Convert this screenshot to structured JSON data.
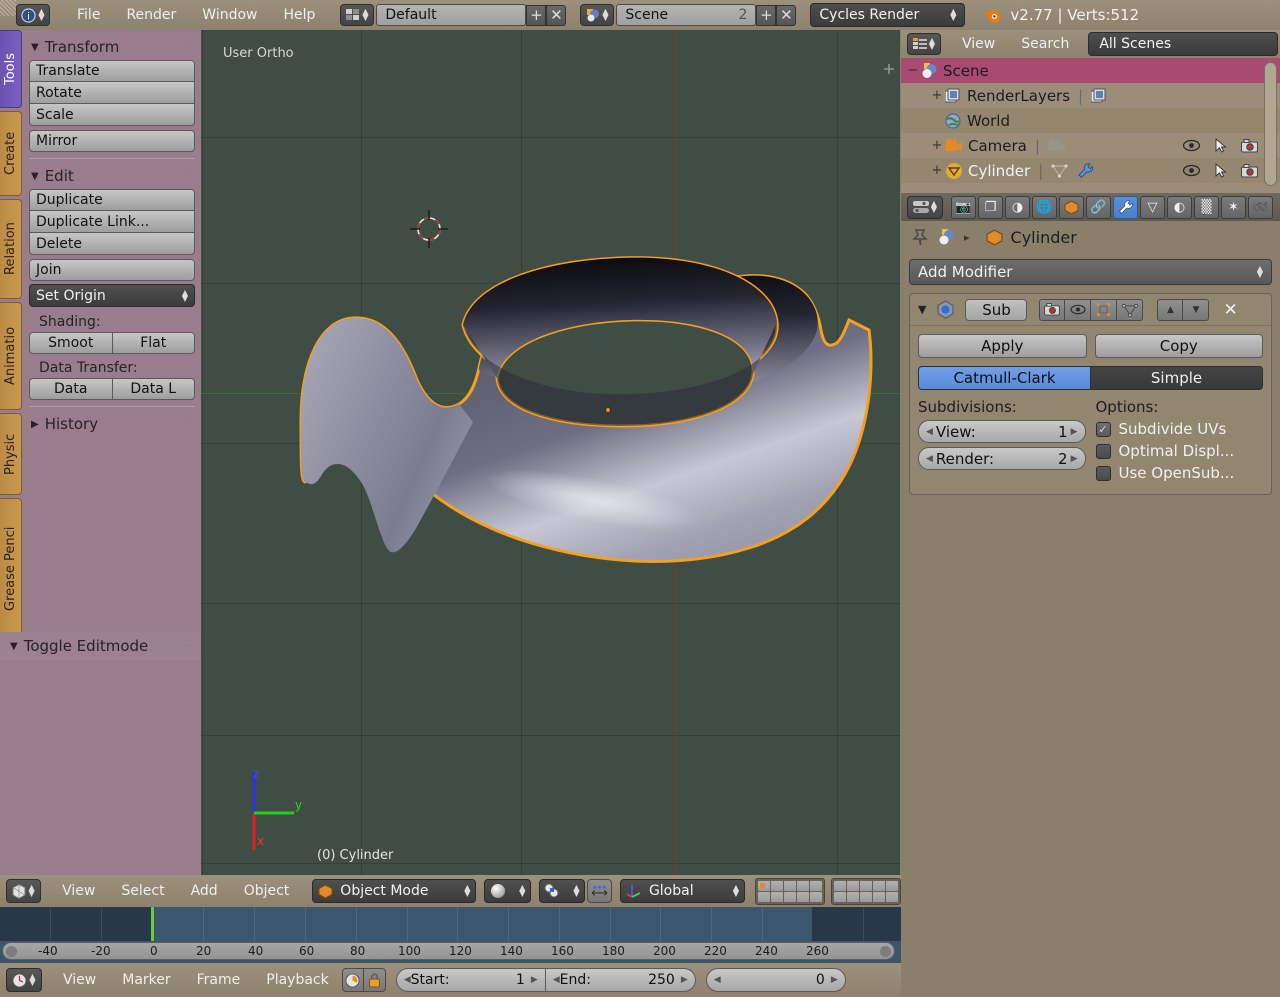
{
  "topbar": {
    "icon": "blender-info-icon",
    "menus": [
      "File",
      "Render",
      "Window",
      "Help"
    ],
    "screen_layout": {
      "icon": "screen-layout-icon",
      "value": "Default",
      "add_label": "+",
      "remove_label": "✕"
    },
    "scene": {
      "icon": "scene-icon",
      "value": "Scene",
      "users": "2",
      "add_label": "+",
      "remove_label": "✕"
    },
    "engine": {
      "value": "Cycles Render"
    },
    "status": {
      "icon": "blender-logo-icon",
      "text": "v2.77 | Verts:512"
    }
  },
  "toolshelf": {
    "tabs": [
      {
        "label": "Tools",
        "active": true
      },
      {
        "label": "Create",
        "active": false
      },
      {
        "label": "Relation",
        "active": false
      },
      {
        "label": "Animatio",
        "active": false
      },
      {
        "label": "Physic",
        "active": false
      },
      {
        "label": "Grease Penci",
        "active": false
      }
    ],
    "panels": [
      {
        "title": "Transform",
        "open": true,
        "groups": [
          {
            "type": "stack",
            "items": [
              "Translate",
              "Rotate",
              "Scale"
            ]
          },
          {
            "type": "single",
            "items": [
              "Mirror"
            ]
          }
        ]
      },
      {
        "title": "Edit",
        "open": true,
        "groups": [
          {
            "type": "stack",
            "items": [
              "Duplicate",
              "Duplicate Link...",
              "Delete"
            ]
          },
          {
            "type": "single",
            "items": [
              "Join"
            ]
          }
        ],
        "dropdown": "Set Origin",
        "sublabels": [
          "Shading:",
          "Data Transfer:"
        ],
        "pairs": [
          [
            "Smoot",
            "Flat"
          ],
          [
            "Data",
            "Data L"
          ]
        ]
      },
      {
        "title": "History",
        "open": false,
        "groups": []
      }
    ],
    "footer_panel": "Toggle Editmode"
  },
  "viewport": {
    "view_label": "User Ortho",
    "object_label": "(0) Cylinder",
    "axes": {
      "x": "x",
      "y": "y",
      "z": "z"
    },
    "colors": {
      "background": "#3f4d45",
      "y_axis": "#8a3030",
      "x_axis": "#3a6a3a",
      "selection_outline": "#f5a01e",
      "axis_x": "#e02020",
      "axis_y": "#20d020",
      "axis_z": "#3030e0"
    }
  },
  "outliner": {
    "header": {
      "icon": "outliner-icon",
      "menus": [
        "View",
        "Search"
      ],
      "display_mode": "All Scenes"
    },
    "rows": [
      {
        "name": "Scene",
        "icon": "scene-icon",
        "expander": "−",
        "indent": 0,
        "selected": true,
        "extra_icons": [],
        "show_restrict": false
      },
      {
        "name": "RenderLayers",
        "icon": "renderlayers-icon",
        "expander": "+",
        "indent": 1,
        "selected": false,
        "extra_icons": [
          "renderlayers-data-icon"
        ],
        "show_restrict": false
      },
      {
        "name": "World",
        "icon": "world-icon",
        "expander": "",
        "indent": 1,
        "selected": false,
        "extra_icons": [],
        "show_restrict": false
      },
      {
        "name": "Camera",
        "icon": "camera-object-icon",
        "expander": "+",
        "indent": 1,
        "selected": false,
        "extra_icons": [
          "camera-data-icon"
        ],
        "show_restrict": true
      },
      {
        "name": "Cylinder",
        "icon": "mesh-object-icon",
        "expander": "+",
        "indent": 1,
        "selected": false,
        "extra_icons": [
          "mesh-data-icon",
          "wrench-modifier-icon"
        ],
        "show_restrict": true
      }
    ],
    "restrict_icons": [
      "eye-icon",
      "cursor-arrow-icon",
      "camera-render-icon"
    ]
  },
  "properties": {
    "tabs": [
      {
        "name": "render-tab",
        "glyph": "📷",
        "active": false
      },
      {
        "name": "render-layers-tab",
        "glyph": "❐",
        "active": false
      },
      {
        "name": "scene-tab",
        "glyph": "◑",
        "active": false
      },
      {
        "name": "world-tab",
        "glyph": "🌐",
        "active": false
      },
      {
        "name": "object-tab",
        "glyph": "⬛",
        "active": false
      },
      {
        "name": "constraints-tab",
        "glyph": "🔗",
        "active": false
      },
      {
        "name": "modifiers-tab",
        "glyph": "🔧",
        "active": true
      },
      {
        "name": "data-tab",
        "glyph": "▽",
        "active": false
      },
      {
        "name": "material-tab",
        "glyph": "◐",
        "active": false
      },
      {
        "name": "texture-tab",
        "glyph": "▒",
        "active": false
      },
      {
        "name": "particles-tab",
        "glyph": "✶",
        "active": false
      },
      {
        "name": "physics-tab",
        "glyph": "➿",
        "active": false
      }
    ],
    "breadcrumb": {
      "pin_icon": "pin-icon",
      "scene_icon": "scene-icon",
      "separator": "▸",
      "object_icon": "mesh-object-icon",
      "object_name": "Cylinder"
    },
    "add_modifier": "Add Modifier",
    "modifier": {
      "expand_icon": "collapse-triangle-icon",
      "type_icon": "subsurf-icon",
      "name": "Sub",
      "display_toggles": [
        "render-toggle-icon",
        "viewport-toggle-icon",
        "edit-mode-toggle-icon",
        "on-cage-toggle-icon"
      ],
      "move_up": "▲",
      "move_down": "▼",
      "close": "✕",
      "apply_label": "Apply",
      "copy_label": "Copy",
      "subdiv_type": [
        {
          "label": "Catmull-Clark",
          "active": true
        },
        {
          "label": "Simple",
          "active": false
        }
      ],
      "subdivisions_label": "Subdivisions:",
      "view_label": "View:",
      "view_value": "1",
      "render_label": "Render:",
      "render_value": "2",
      "options_label": "Options:",
      "options": [
        {
          "label": "Subdivide UVs",
          "checked": true
        },
        {
          "label": "Optimal Displ...",
          "checked": false
        },
        {
          "label": "Use OpenSub...",
          "checked": false
        }
      ]
    }
  },
  "viewport_header": {
    "editor_icon": "editor-type-3dview-icon",
    "menus": [
      "View",
      "Select",
      "Add",
      "Object"
    ],
    "mode": {
      "icon": "object-mode-icon",
      "value": "Object Mode"
    },
    "shading": {
      "icon": "solid-shading-icon"
    },
    "pivot": {
      "icon": "pivot-median-icon"
    },
    "snap": {
      "icon": "proportional-edit-icon"
    },
    "orientation": {
      "icon": "transform-orientation-icon",
      "value": "Global"
    },
    "layers": {
      "group1_active_index": 0,
      "group1_count": 10,
      "group2_count": 10
    }
  },
  "timeline": {
    "tick_labels": [
      "-40",
      "-20",
      "0",
      "20",
      "40",
      "60",
      "80",
      "100",
      "120",
      "140",
      "160",
      "180",
      "200",
      "220",
      "240",
      "260"
    ],
    "playhead_frame": "0",
    "range_start": "1",
    "range_end": "250"
  },
  "timeline_header": {
    "editor_icon": "editor-type-timeline-icon",
    "menus": [
      "View",
      "Marker",
      "Frame",
      "Playback"
    ],
    "toggles": [
      "auto-keyframe-icon",
      "lock-icon"
    ],
    "start_label": "Start:",
    "start_value": "1",
    "end_label": "End:",
    "end_value": "250",
    "current_frame_value": "0"
  }
}
